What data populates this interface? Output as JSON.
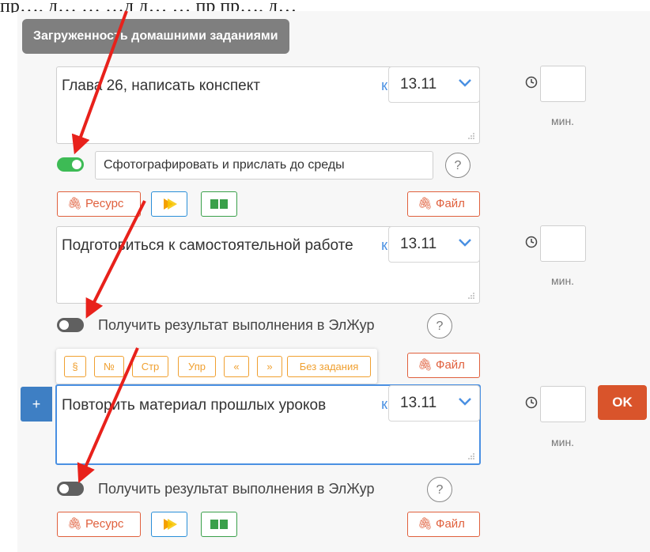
{
  "top_strip_text": "пр…, д…  …  …д д…  …  пр  пр…, д…",
  "section_title": "Загруженность домашними заданиями",
  "icons": {
    "clock": "clock-icon",
    "paperclip": "paperclip-icon",
    "help": "question-circle-icon",
    "chevron": "chevron-down-icon",
    "media": "media-play-icon",
    "book": "book-icon",
    "arrow": "red-annotation-arrow"
  },
  "colors": {
    "accent_blue": "#4a90e2",
    "toggle_on": "#3dbb55",
    "toggle_off": "#606060",
    "resource_red": "#e0603d",
    "tag_orange": "#f0a030",
    "ok_button": "#d9542b",
    "annotation_arrow": "#e8211b"
  },
  "tasks": [
    {
      "text": "Глава 26, написать конспект",
      "due_prefix": "к",
      "due_date": "13.11",
      "minutes_value": "",
      "minutes_label": "мин.",
      "toggle_on": true,
      "note": "Сфотографировать и прислать до среды",
      "help": "?",
      "resource_label": "Ресурс",
      "file_label": "Файл"
    },
    {
      "text": "Подготовиться к самостоятельной работе",
      "due_prefix": "к",
      "due_date": "13.11",
      "minutes_value": "",
      "minutes_label": "мин.",
      "toggle_on": false,
      "toggle_label": "Получить результат выполнения в ЭлЖур",
      "help": "?",
      "file_label": "Файл"
    },
    {
      "text": "Повторить материал прошлых уроков",
      "due_prefix": "к",
      "due_date": "13.11",
      "minutes_value": "",
      "minutes_label": "мин.",
      "toggle_on": false,
      "toggle_label": "Получить результат выполнения в ЭлЖур",
      "help": "?",
      "resource_label": "Ресурс",
      "file_label": "Файл",
      "plus_label": "+",
      "ok_label": "OK"
    }
  ],
  "format_tags": [
    "§",
    "№",
    "Стр",
    "Упр",
    "«",
    "»",
    "Без задания"
  ]
}
